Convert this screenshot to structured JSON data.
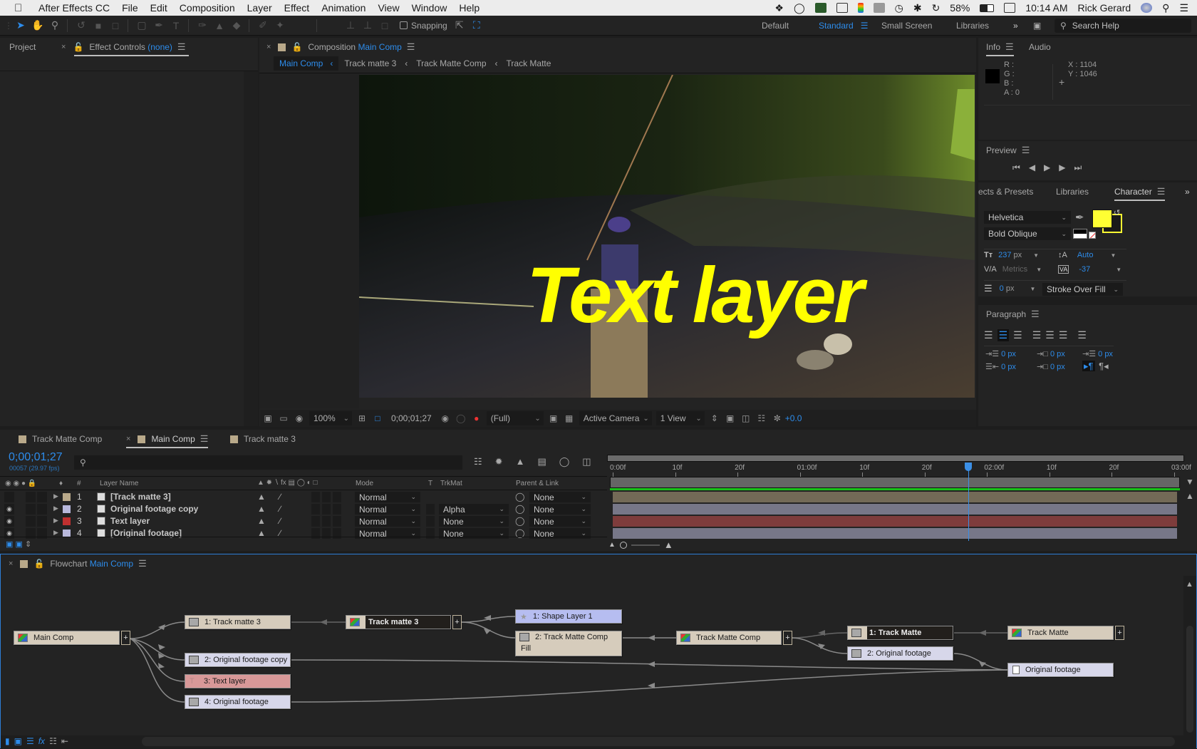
{
  "menubar": {
    "app_name": "After Effects CC",
    "items": [
      "File",
      "Edit",
      "Composition",
      "Layer",
      "Effect",
      "Animation",
      "View",
      "Window",
      "Help"
    ],
    "battery": "58%",
    "clock": "10:14 AM",
    "user": "Rick Gerard"
  },
  "toolbar": {
    "snapping_label": "Snapping",
    "workspaces": [
      "Default",
      "Standard",
      "Small Screen",
      "Libraries"
    ],
    "active_workspace": "Standard",
    "search_placeholder": "Search Help"
  },
  "left_panel": {
    "tab_project": "Project",
    "tab_effect_controls": "Effect Controls",
    "effect_controls_target": "(none)"
  },
  "composition_panel": {
    "title_prefix": "Composition",
    "title_comp": "Main Comp",
    "breadcrumbs": [
      "Main Comp",
      "Track matte 3",
      "Track Matte Comp",
      "Track Matte"
    ],
    "overlay_text": "Text layer",
    "bottom_bar": {
      "zoom": "100%",
      "timecode": "0;00;01;27",
      "resolution": "(Full)",
      "camera": "Active Camera",
      "views": "1 View",
      "exposure": "+0.0"
    }
  },
  "info_panel": {
    "tab_info": "Info",
    "tab_audio": "Audio",
    "r_label": "R :",
    "g_label": "G :",
    "b_label": "B :",
    "a_label": "A :",
    "a_value": "0",
    "x_label": "X :",
    "x_value": "1104",
    "y_label": "Y :",
    "y_value": "1046"
  },
  "preview_panel": {
    "title": "Preview"
  },
  "character_panel": {
    "tabs": [
      "ects & Presets",
      "Libraries",
      "Character"
    ],
    "font_family": "Helvetica",
    "font_style": "Bold Oblique",
    "fill_color": "#ffff33",
    "stroke_color": "#ffff33",
    "font_size": "237",
    "font_size_unit": "px",
    "leading": "Auto",
    "kerning": "Metrics",
    "tracking": "-37",
    "stroke_width": "0",
    "stroke_unit": "px",
    "stroke_mode": "Stroke Over Fill"
  },
  "paragraph_panel": {
    "title": "Paragraph",
    "indent_left": "0 px",
    "indent_first": "0 px",
    "space_before": "0 px",
    "indent_right": "0 px",
    "space_after": "0 px"
  },
  "timeline": {
    "tabs": [
      "Track Matte Comp",
      "Main Comp",
      "Track matte 3"
    ],
    "active_tab": "Main Comp",
    "timecode": "0;00;01;27",
    "frame_info": "00057 (29.97 fps)",
    "search_placeholder": "",
    "columns": {
      "layer_name": "Layer Name",
      "mode": "Mode",
      "t": "T",
      "trkmat": "TrkMat",
      "parent": "Parent & Link",
      "num": "#"
    },
    "ruler": [
      "0:00f",
      "10f",
      "20f",
      "01:00f",
      "10f",
      "20f",
      "02:00f",
      "10f",
      "20f",
      "03:00f"
    ],
    "playhead_position_frames": 57,
    "duration_frames": 90,
    "layers": [
      {
        "num": "1",
        "name": "[Track matte 3]",
        "label_color": "#b9a98a",
        "bar_color": "#736a57",
        "mode": "Normal",
        "trkmat": "",
        "parent": "None",
        "visible": false
      },
      {
        "num": "2",
        "name": "Original footage copy",
        "label_color": "#b8b8dc",
        "bar_color": "#777788",
        "mode": "Normal",
        "trkmat": "Alpha",
        "parent": "None",
        "visible": true
      },
      {
        "num": "3",
        "name": "Text layer",
        "label_color": "#c03030",
        "bar_color": "#7e3c3c",
        "mode": "Normal",
        "trkmat": "None",
        "parent": "None",
        "visible": true
      },
      {
        "num": "4",
        "name": "[Original footage]",
        "label_color": "#b8b8dc",
        "bar_color": "#777788",
        "mode": "Normal",
        "trkmat": "None",
        "parent": "None",
        "visible": true
      }
    ]
  },
  "flowchart": {
    "title_prefix": "Flowchart",
    "title_comp": "Main Comp",
    "nodes": {
      "main_comp": "Main Comp",
      "l1_track_matte_3": "1: Track matte 3",
      "l2_original_footage_copy": "2: Original footage copy",
      "l3_text_layer": "3: Text layer",
      "l4_original_footage": "4: Original footage",
      "track_matte_3": "Track matte 3",
      "shape_layer_1": "1: Shape Layer 1",
      "track_matte_comp_layer": "2: Track Matte Comp",
      "track_matte_comp_layer_sub": "Fill",
      "track_matte_comp": "Track Matte Comp",
      "tm_layer_1": "1: Track Matte",
      "tm_layer_2": "2: Original footage",
      "track_matte": "Track Matte",
      "original_footage": "Original footage"
    }
  }
}
